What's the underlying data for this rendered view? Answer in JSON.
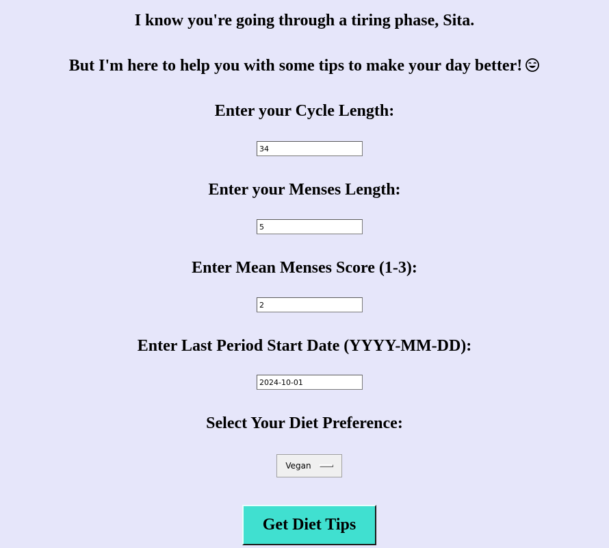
{
  "header": {
    "greeting": "I know you're going through a tiring phase, Sita.",
    "subgreeting": "But I'm here to help you with some tips to make your day better!",
    "emoji_icon": "smiling-face-icon"
  },
  "form": {
    "cycle_length": {
      "label": "Enter your Cycle Length:",
      "value": "34"
    },
    "menses_length": {
      "label": "Enter your Menses Length:",
      "value": "5"
    },
    "menses_score": {
      "label": "Enter Mean Menses Score (1-3):",
      "value": "2"
    },
    "last_period": {
      "label": "Enter Last Period Start Date (YYYY-MM-DD):",
      "value": "2024-10-01"
    },
    "diet": {
      "label": "Select Your Diet Preference:",
      "selected": "Vegan"
    }
  },
  "actions": {
    "submit_label": "Get Diet Tips"
  },
  "colors": {
    "background": "#e6e6fa",
    "button": "#40e0d0"
  }
}
